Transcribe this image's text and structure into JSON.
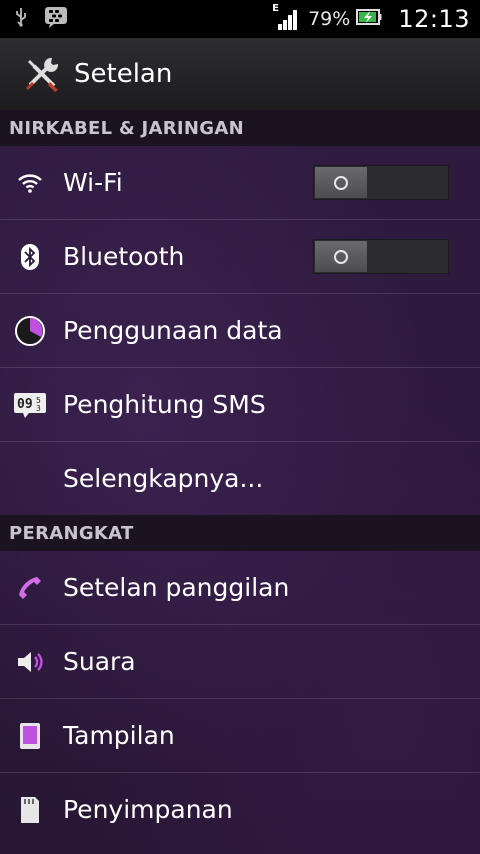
{
  "status_bar": {
    "network_type": "E",
    "battery_percent": "79%",
    "time": "12:13"
  },
  "action_bar": {
    "title": "Setelan"
  },
  "sections": [
    {
      "header": "NIRKABEL & JARINGAN",
      "items": [
        {
          "label": "Wi-Fi",
          "icon": "wifi-icon",
          "toggle": "off"
        },
        {
          "label": "Bluetooth",
          "icon": "bluetooth-icon",
          "toggle": "off"
        },
        {
          "label": "Penggunaan data",
          "icon": "data-usage-icon"
        },
        {
          "label": "Penghitung SMS",
          "icon": "sms-counter-icon"
        },
        {
          "label": "Selengkapnya...",
          "icon": ""
        }
      ]
    },
    {
      "header": "PERANGKAT",
      "items": [
        {
          "label": "Setelan panggilan",
          "icon": "phone-icon"
        },
        {
          "label": "Suara",
          "icon": "speaker-icon"
        },
        {
          "label": "Tampilan",
          "icon": "display-icon"
        },
        {
          "label": "Penyimpanan",
          "icon": "sd-card-icon"
        }
      ]
    }
  ],
  "colors": {
    "accent": "#c050e0",
    "background": "#2f1b40",
    "section_header_bg": "#1b1420"
  }
}
